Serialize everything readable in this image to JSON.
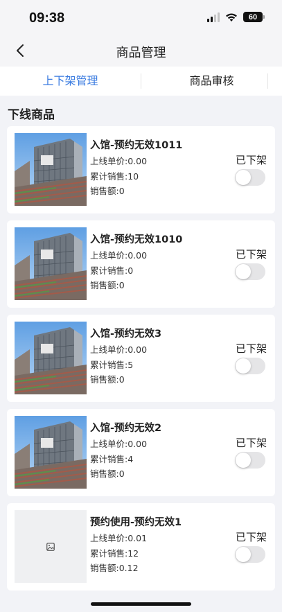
{
  "status_bar": {
    "time": "09:38",
    "battery": "60"
  },
  "nav": {
    "title": "商品管理",
    "back_icon": "chevron-left-icon"
  },
  "tabs": [
    {
      "label": "上下架管理",
      "active": true
    },
    {
      "label": "商品审核",
      "active": false
    }
  ],
  "section": {
    "title": "下线商品"
  },
  "products": [
    {
      "name": "入馆-预约无效1011",
      "price": "上线单价:0.00",
      "sales_count": "累计销售:10",
      "sales_amount": "销售额:0",
      "status": "已下架",
      "toggle_on": false,
      "has_image": true
    },
    {
      "name": "入馆-预约无效1010",
      "price": "上线单价:0.00",
      "sales_count": "累计销售:0",
      "sales_amount": "销售额:0",
      "status": "已下架",
      "toggle_on": false,
      "has_image": true
    },
    {
      "name": "入馆-预约无效3",
      "price": "上线单价:0.00",
      "sales_count": "累计销售:5",
      "sales_amount": "销售额:0",
      "status": "已下架",
      "toggle_on": false,
      "has_image": true
    },
    {
      "name": "入馆-预约无效2",
      "price": "上线单价:0.00",
      "sales_count": "累计销售:4",
      "sales_amount": "销售额:0",
      "status": "已下架",
      "toggle_on": false,
      "has_image": true
    },
    {
      "name": "预约使用-预约无效1",
      "price": "上线单价:0.01",
      "sales_count": "累计销售:12",
      "sales_amount": "销售额:0.12",
      "status": "已下架",
      "toggle_on": false,
      "has_image": false
    }
  ],
  "colors": {
    "accent": "#3a7be0",
    "background": "#f2f3f7"
  }
}
